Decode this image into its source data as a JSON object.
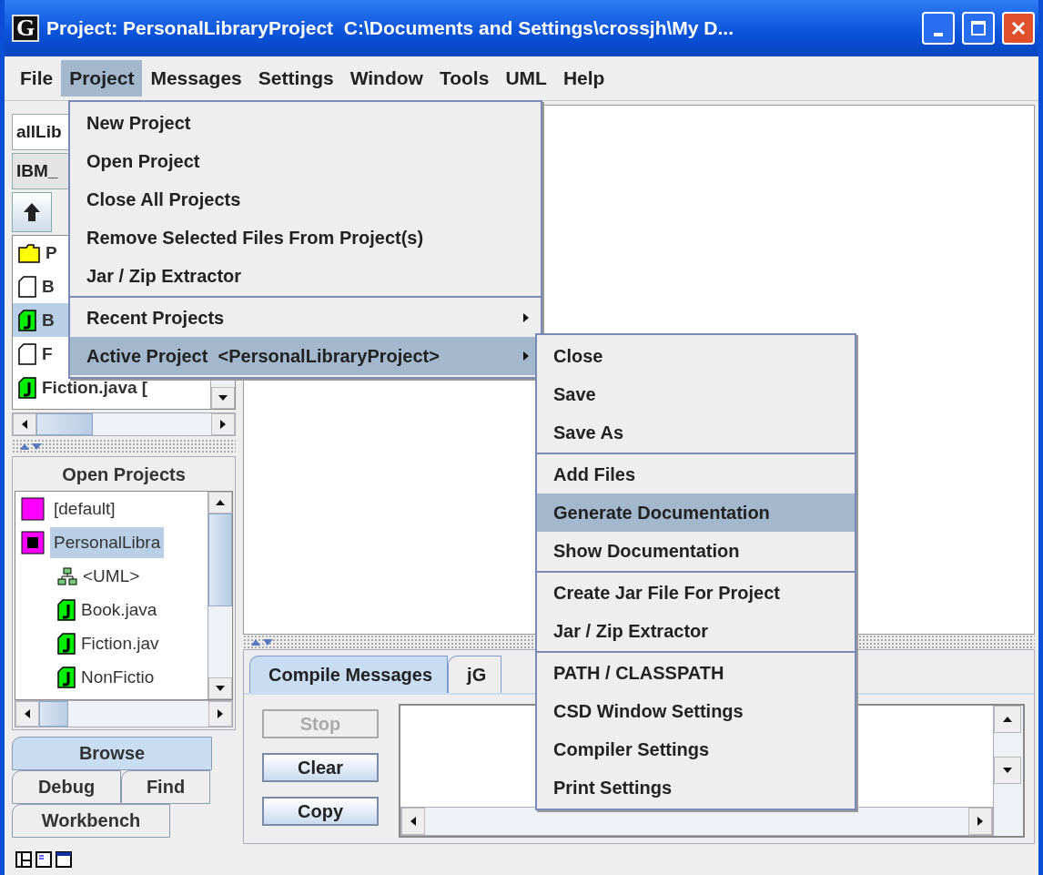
{
  "window": {
    "icon_letter": "G",
    "title": "Project: PersonalLibraryProject  C:\\Documents and Settings\\crossjh\\My D..."
  },
  "menu_bar": [
    {
      "label": "File",
      "selected": false
    },
    {
      "label": "Project",
      "selected": true
    },
    {
      "label": "Messages",
      "selected": false
    },
    {
      "label": "Settings",
      "selected": false
    },
    {
      "label": "Window",
      "selected": false
    },
    {
      "label": "Tools",
      "selected": false
    },
    {
      "label": "UML",
      "selected": false
    },
    {
      "label": "Help",
      "selected": false
    }
  ],
  "project_menu": {
    "groups": [
      [
        {
          "label": "New Project",
          "selected": false,
          "submenu": false
        },
        {
          "label": "Open Project",
          "selected": false,
          "submenu": false
        },
        {
          "label": "Close All Projects",
          "selected": false,
          "submenu": false
        },
        {
          "label": "Remove Selected Files From Project(s)",
          "selected": false,
          "submenu": false
        },
        {
          "label": "Jar / Zip Extractor",
          "selected": false,
          "submenu": false
        }
      ],
      [
        {
          "label": "Recent Projects",
          "selected": false,
          "submenu": true
        },
        {
          "label": "Active Project  <PersonalLibraryProject>",
          "selected": true,
          "submenu": true
        }
      ]
    ]
  },
  "active_project_submenu": {
    "groups": [
      [
        {
          "label": "Close",
          "selected": false
        },
        {
          "label": "Save",
          "selected": false
        },
        {
          "label": "Save As",
          "selected": false
        }
      ],
      [
        {
          "label": "Add Files",
          "selected": false
        },
        {
          "label": "Generate Documentation",
          "selected": true
        },
        {
          "label": "Show Documentation",
          "selected": false
        }
      ],
      [
        {
          "label": "Create Jar File For Project",
          "selected": false
        },
        {
          "label": "Jar / Zip Extractor",
          "selected": false
        }
      ],
      [
        {
          "label": "PATH / CLASSPATH",
          "selected": false
        },
        {
          "label": "CSD Window Settings",
          "selected": false
        },
        {
          "label": "Compiler Settings",
          "selected": false
        },
        {
          "label": "Print Settings",
          "selected": false
        }
      ]
    ]
  },
  "browse": {
    "directory_combo": "allLib",
    "drive_combo": "IBM_",
    "files": [
      {
        "kind": "folder",
        "name": "P",
        "selected": false
      },
      {
        "kind": "file",
        "name": "B",
        "selected": false
      },
      {
        "kind": "java",
        "name": "B",
        "selected": true
      },
      {
        "kind": "file",
        "name": "F",
        "selected": false
      },
      {
        "kind": "java",
        "name": "Fiction.java [",
        "selected": false
      }
    ]
  },
  "open_projects": {
    "title": "Open Projects",
    "projects": [
      {
        "name": "[default]",
        "active": false,
        "selected": false
      },
      {
        "name": "PersonalLibra",
        "active": true,
        "selected": true,
        "children": [
          {
            "kind": "uml",
            "name": "<UML>"
          },
          {
            "kind": "java",
            "name": "Book.java"
          },
          {
            "kind": "java",
            "name": "Fiction.jav"
          },
          {
            "kind": "java",
            "name": "NonFictio"
          }
        ]
      }
    ]
  },
  "left_tabs": [
    {
      "label": "Browse",
      "selected": true
    },
    {
      "label": "Debug",
      "selected": false
    },
    {
      "label": "Find",
      "selected": false
    },
    {
      "label": "Workbench",
      "selected": false
    }
  ],
  "messages": {
    "tabs": [
      {
        "label": "Compile Messages",
        "selected": true
      },
      {
        "label": "jG",
        "selected": false
      }
    ],
    "buttons": [
      {
        "label": "Stop",
        "disabled": true
      },
      {
        "label": "Clear",
        "disabled": false
      },
      {
        "label": "Copy",
        "disabled": false
      }
    ]
  }
}
